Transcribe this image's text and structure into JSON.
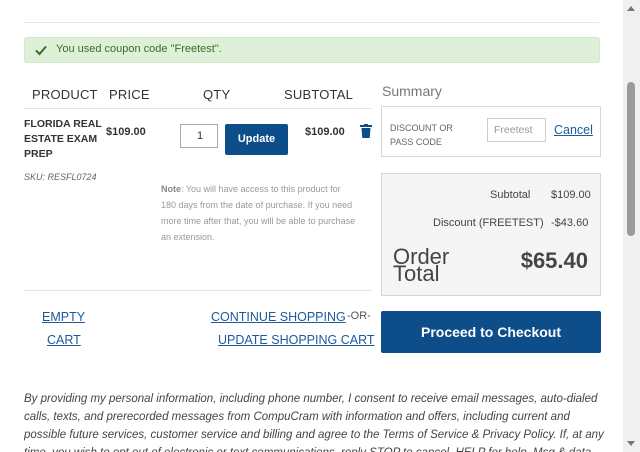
{
  "alert": {
    "message": "You used coupon code \"Freetest\".",
    "icon": "check-icon",
    "color": "#3c6e23"
  },
  "cart": {
    "headers": {
      "product": "PRODUCT",
      "price": "PRICE",
      "qty": "QTY",
      "subtotal": "SUBTOTAL"
    },
    "item": {
      "name": "FLORIDA REAL ESTATE EXAM PREP",
      "sku": "SKU: RESFL0724",
      "price": "$109.00",
      "qty": "1",
      "update_label": "Update",
      "subtotal": "$109.00",
      "note_label": "Note",
      "note_text": ": You will have access to this product for 180 days from the date of purchase. If you need more time after that, you will be able to purchase an extension."
    },
    "links": {
      "empty_cart_line1": "EMPTY",
      "empty_cart_line2": "CART",
      "continue_shopping": "CONTINUE SHOPPING",
      "or": "-OR-",
      "update_cart": "UPDATE SHOPPING CART"
    }
  },
  "summary": {
    "title": "Summary",
    "coupon_label": "DISCOUNT OR PASS CODE",
    "coupon_placeholder": "Freetest",
    "cancel_label": "Cancel",
    "subtotal_label": "Subtotal",
    "subtotal_value": "$109.00",
    "discount_label": "Discount (FREETEST)",
    "discount_value": "-$43.60",
    "order_total_label_1": "Order",
    "order_total_label_2": "Total",
    "order_total_value": "$65.40",
    "checkout_label": "Proceed to Checkout"
  },
  "disclaimer": "By providing my personal information, including phone number, I consent to receive email messages, auto-dialed calls, texts, and prerecorded messages from CompuCram with information and offers, including current and possible future services, customer service and billing and agree to the Terms of Service & Privacy Policy. If, at any time, you wish to opt out of electronic or text communications, reply STOP to cancel. HELP for help. Msg & data",
  "colors": {
    "primary": "#0d4e8a",
    "link": "#1c5a9a",
    "alert_bg": "#dff0d8"
  }
}
